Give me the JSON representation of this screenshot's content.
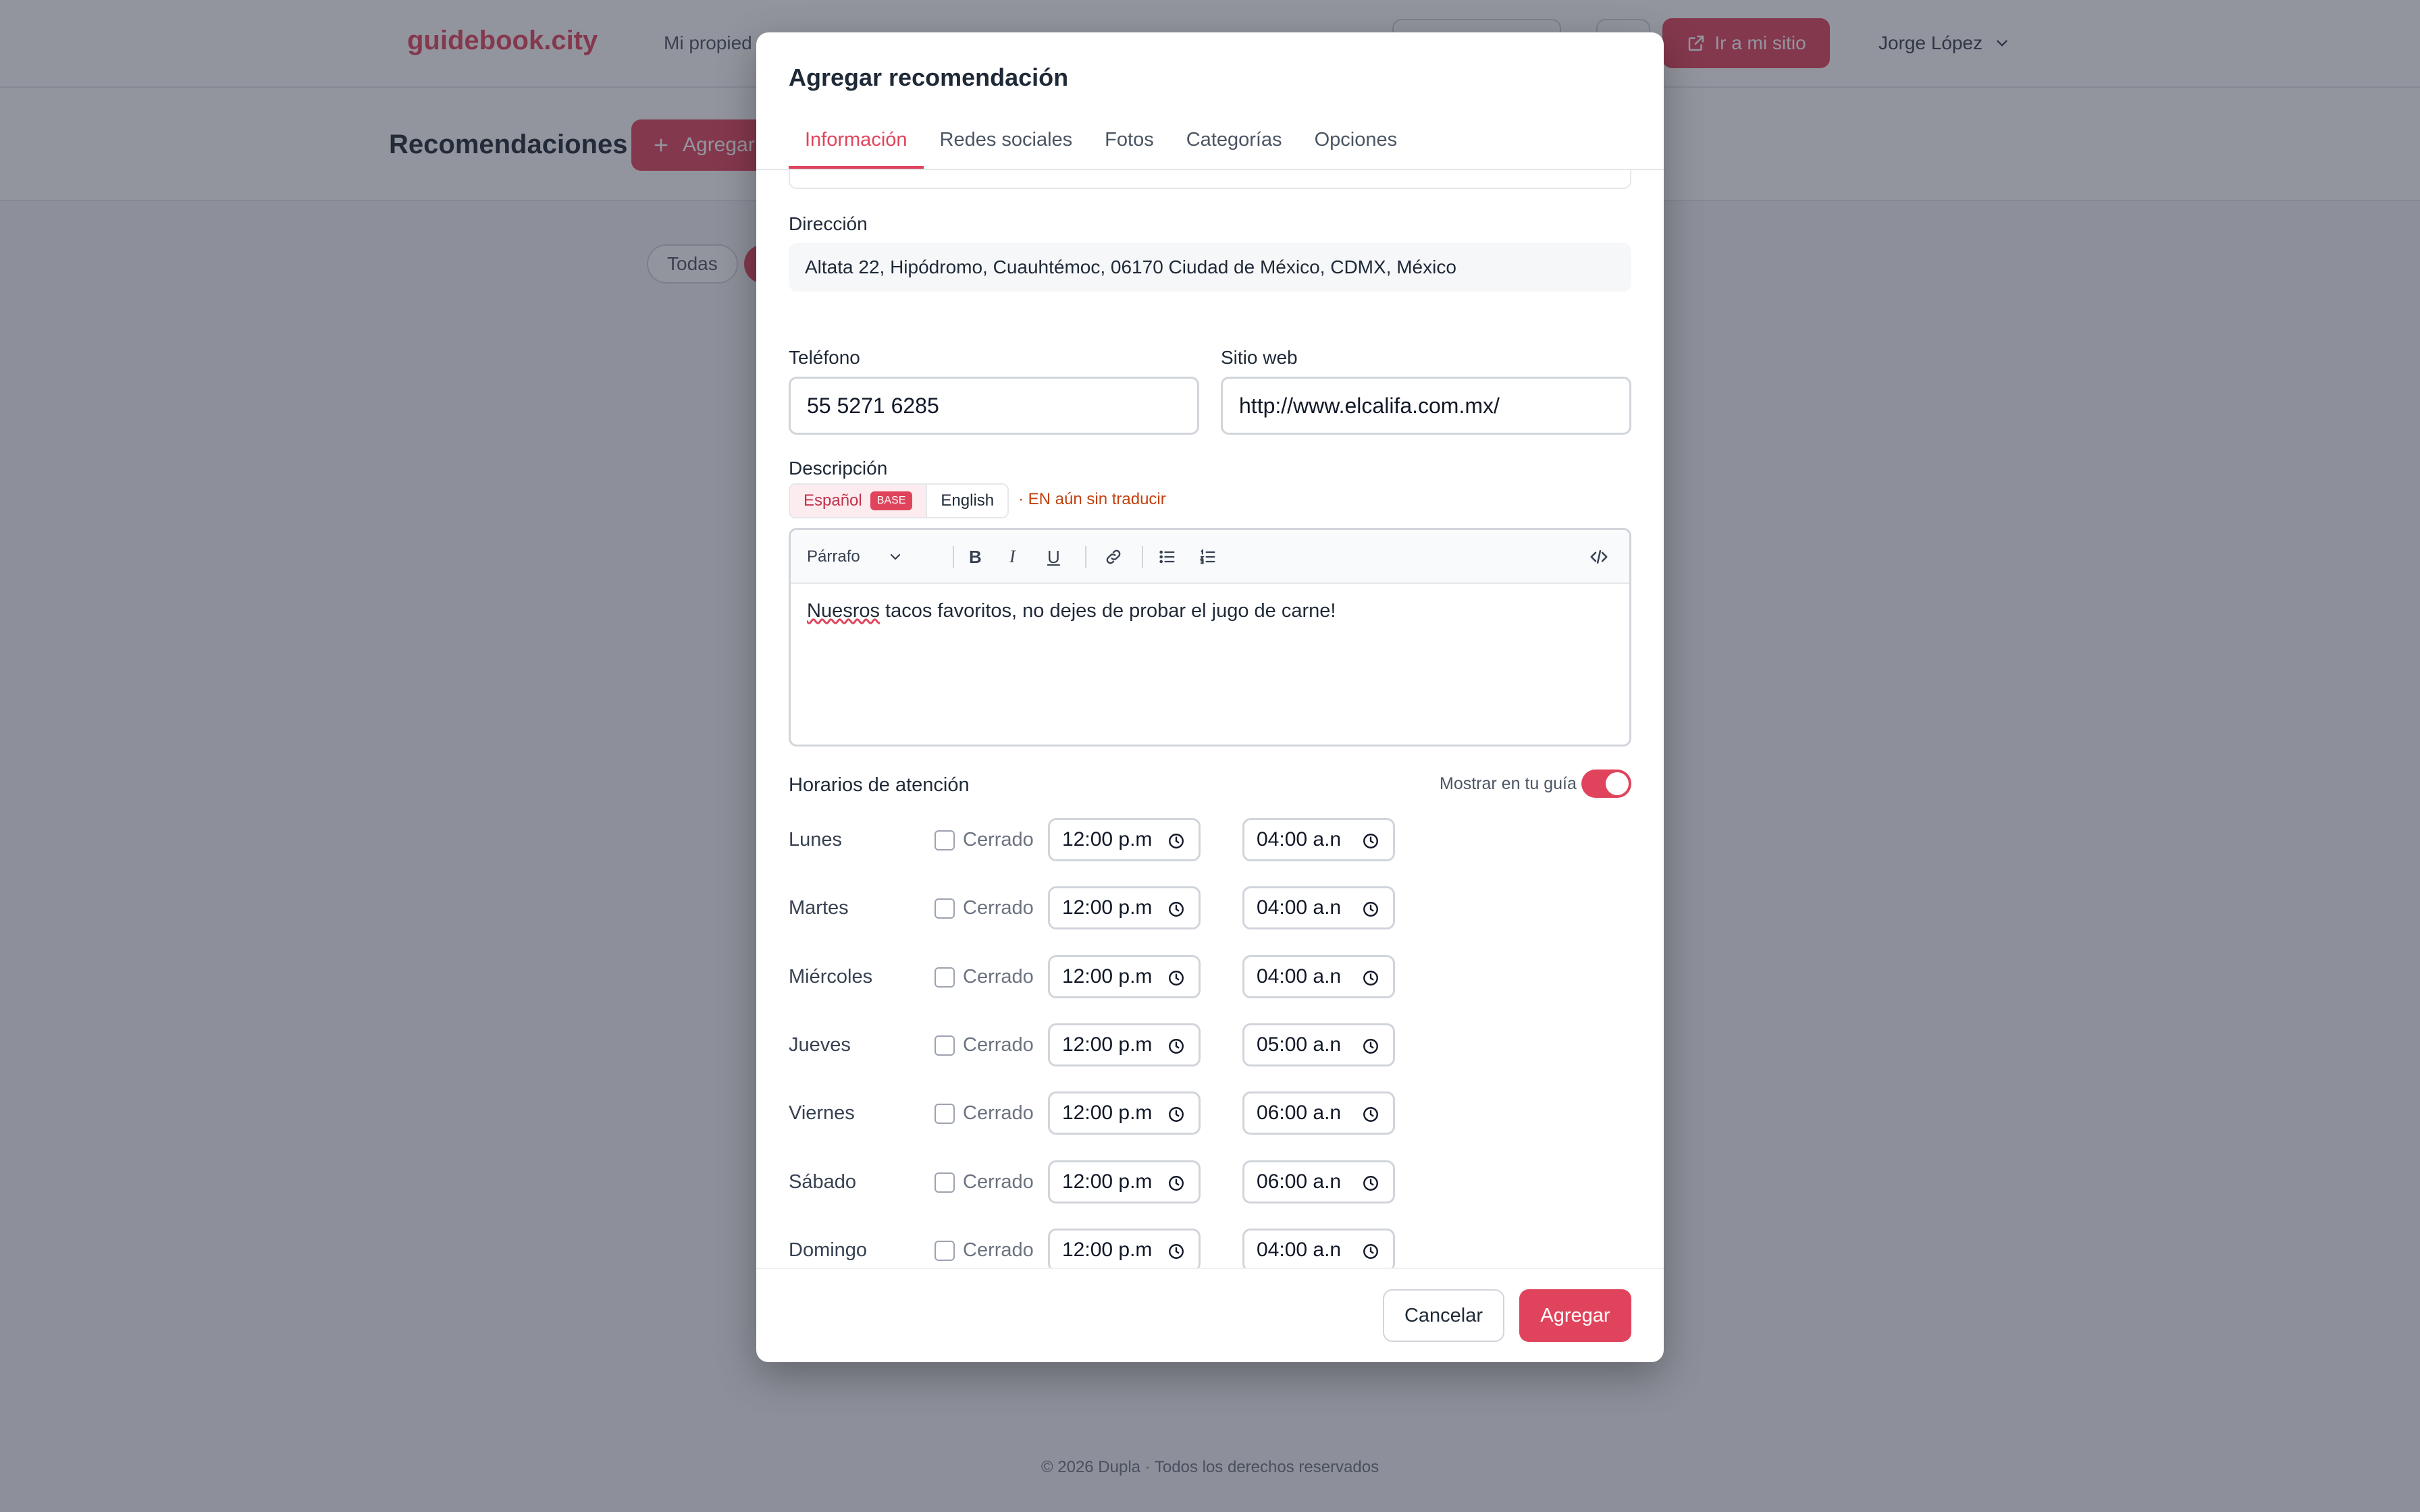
{
  "app": {
    "logo": "guidebook.city",
    "nav_link": "Mi propied",
    "site_button": "Ir a mi sitio",
    "user_name": "Jorge López",
    "page_title": "Recomendaciones",
    "add_button": "Agregar",
    "filter_all": "Todas",
    "footer": "© 2026 Dupla · Todos los derechos reservados"
  },
  "modal": {
    "title": "Agregar recomendación",
    "tabs": [
      {
        "label": "Información",
        "active": true
      },
      {
        "label": "Redes sociales"
      },
      {
        "label": "Fotos"
      },
      {
        "label": "Categorías"
      },
      {
        "label": "Opciones"
      }
    ],
    "address": {
      "label": "Dirección",
      "value": "Altata 22, Hipódromo, Cuauhtémoc, 06170 Ciudad de México, CDMX, México"
    },
    "phone": {
      "label": "Teléfono",
      "value": "55 5271 6285"
    },
    "website": {
      "label": "Sitio web",
      "value": "http://www.elcalifa.com.mx/"
    },
    "description": {
      "label": "Descripción",
      "lang_es": "Español",
      "base_badge": "BASE",
      "lang_en": "English",
      "untranslated": "· EN aún sin traducir",
      "paragraph_select": "Párrafo",
      "misspelled_word": "Nuesros",
      "content_rest": " tacos favoritos, no dejes de probar el jugo de carne!"
    },
    "hours": {
      "title": "Horarios de atención",
      "show_label": "Mostrar en tu guía",
      "show_enabled": true,
      "closed_label": "Cerrado",
      "dash": "–",
      "days": [
        {
          "name": "Lunes",
          "open": "12:00 p.m",
          "close": "04:00 a.n"
        },
        {
          "name": "Martes",
          "open": "12:00 p.m",
          "close": "04:00 a.n"
        },
        {
          "name": "Miércoles",
          "open": "12:00 p.m",
          "close": "04:00 a.n"
        },
        {
          "name": "Jueves",
          "open": "12:00 p.m",
          "close": "05:00 a.n"
        },
        {
          "name": "Viernes",
          "open": "12:00 p.m",
          "close": "06:00 a.n"
        },
        {
          "name": "Sábado",
          "open": "12:00 p.m",
          "close": "06:00 a.n"
        },
        {
          "name": "Domingo",
          "open": "12:00 p.m",
          "close": "04:00 a.n"
        }
      ]
    },
    "cancel_button": "Cancelar",
    "submit_button": "Agregar"
  },
  "colors": {
    "accent": "#e0445c",
    "overlay": "#282c3e"
  }
}
